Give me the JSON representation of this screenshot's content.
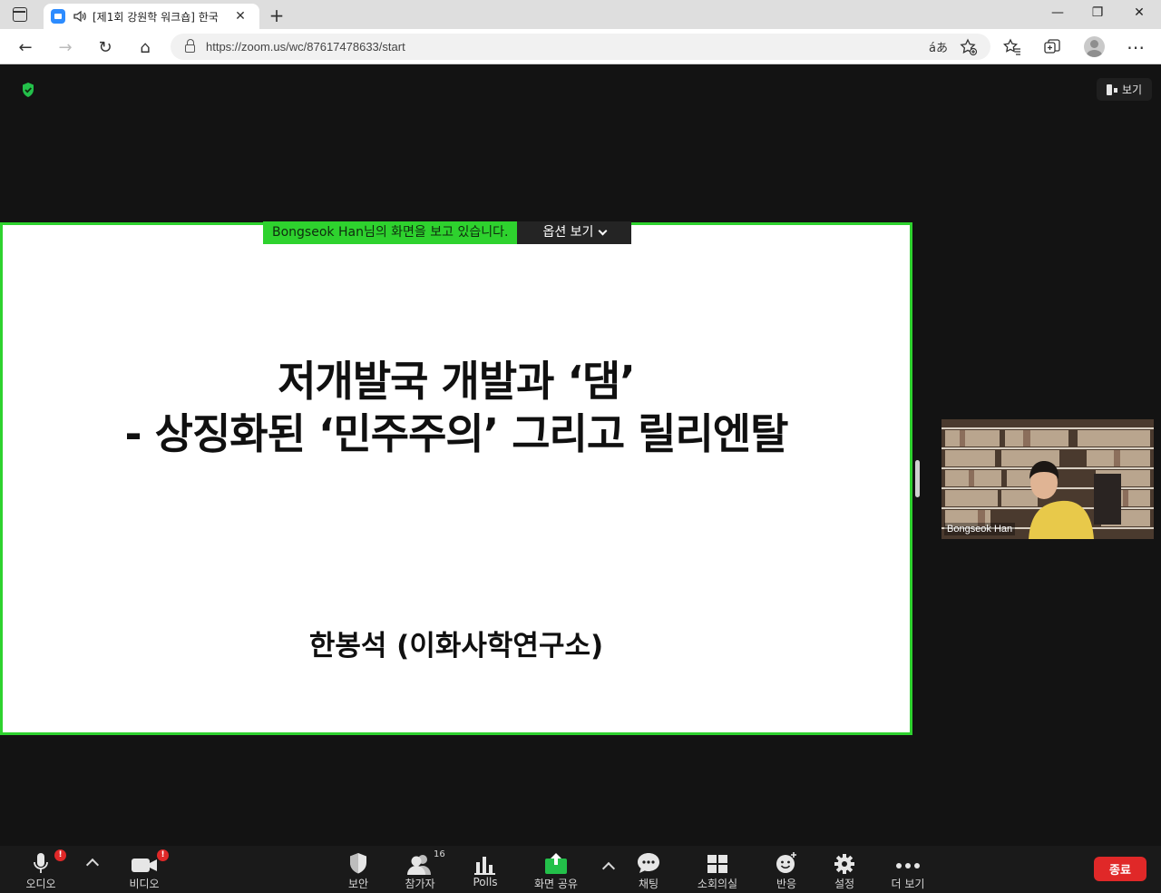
{
  "browser": {
    "tab_title": "[제1회 강원학 워크숍] 한국",
    "tab_close": "✕",
    "new_tab": "+",
    "url": "https://zoom.us/wc/87617478633/start",
    "read_aloud": "áあ",
    "window_minimize": "—",
    "window_maximize": "❐",
    "window_close": "✕",
    "back": "←",
    "forward": "→",
    "reload": "↻",
    "home": "⌂",
    "more": "⋯"
  },
  "meeting": {
    "view_button": "보기",
    "share_banner_name": "Bongseok Han",
    "share_banner_suffix": "님의 화면을 보고 있습니다.",
    "view_options": "옵션 보기"
  },
  "slide": {
    "title_line1": "저개발국 개발과 ‘댐’",
    "title_line2": "- 상징화된 ‘민주주의’ 그리고 릴리엔탈",
    "author": "한봉석 (이화사학연구소)"
  },
  "video": {
    "participant_name": "Bongseok Han"
  },
  "toolbar": {
    "audio": "오디오",
    "video": "비디오",
    "security": "보안",
    "participants": "참가자",
    "participants_count": "16",
    "polls": "Polls",
    "share_screen": "화면 공유",
    "chat": "채팅",
    "breakout": "소회의실",
    "reactions": "반응",
    "settings": "설정",
    "more": "더 보기",
    "end": "종료",
    "alert_badge": "!"
  },
  "colors": {
    "share_green": "#2ed22e",
    "end_red": "#e02828",
    "zoom_blue": "#2d8cff"
  }
}
